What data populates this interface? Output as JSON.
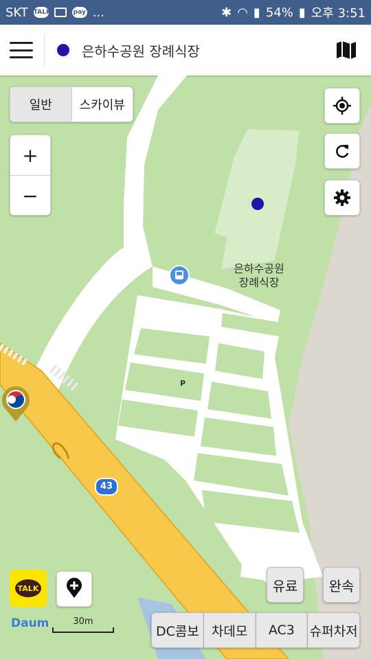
{
  "status_bar": {
    "carrier": "SKT",
    "talk_badge": "TALK",
    "pay_badge": "pay",
    "overflow": "...",
    "battery": "54%",
    "time": "오후 3:51"
  },
  "header": {
    "title": "은하수공원 장례식장",
    "dot_color": "#1f16a8"
  },
  "map": {
    "view_toggle": {
      "options": [
        "일반",
        "스카이뷰"
      ],
      "selected": "일반"
    },
    "zoom": {
      "in_label": "+",
      "out_label": "−"
    },
    "right_buttons": [
      "my-location-icon",
      "refresh-icon",
      "gear-icon"
    ],
    "place_label": [
      "은하수공원",
      "장례식장"
    ],
    "road_number": "43",
    "kakao_talk_label": "TALK",
    "logo_text": "Daum",
    "scale_label": "30m",
    "colors": {
      "grass": "#bfe0a6",
      "building": "#d9ecc9",
      "road": "#ffffff",
      "highway": "#f7c84a",
      "ground": "#ddd8cf"
    }
  },
  "filters": {
    "row1": [
      "유료",
      "완속"
    ],
    "row2": [
      "DC콤보",
      "차데모",
      "AC3",
      "슈퍼차저"
    ]
  }
}
